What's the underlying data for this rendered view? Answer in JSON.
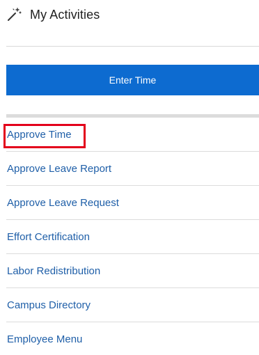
{
  "header": {
    "title": "My Activities",
    "icon": "magic-wand-icon"
  },
  "primary_action": {
    "label": "Enter Time",
    "color": "#0d6bd0"
  },
  "activities": [
    {
      "label": "Approve Time",
      "highlighted": true
    },
    {
      "label": "Approve Leave Report",
      "highlighted": false
    },
    {
      "label": "Approve Leave Request",
      "highlighted": false
    },
    {
      "label": "Effort Certification",
      "highlighted": false
    },
    {
      "label": "Labor Redistribution",
      "highlighted": false
    },
    {
      "label": "Campus Directory",
      "highlighted": false
    },
    {
      "label": "Employee Menu",
      "highlighted": false
    }
  ],
  "colors": {
    "link": "#1f5fa8",
    "highlight": "#e3001b"
  }
}
